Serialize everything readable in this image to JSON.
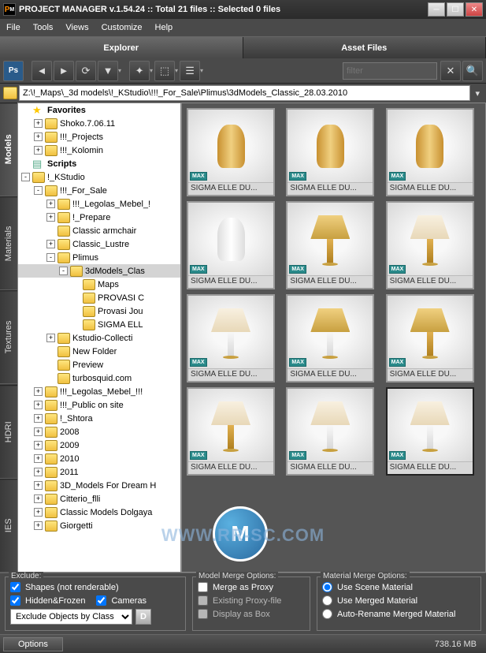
{
  "title": "PROJECT MANAGER v.1.54.24    :: Total 21 files  :: Selected 0 files",
  "menu": [
    "File",
    "Tools",
    "Views",
    "Customize",
    "Help"
  ],
  "main_tabs": {
    "explorer": "Explorer",
    "asset": "Asset Files"
  },
  "filter_placeholder": "filter",
  "path": "Z:\\!_Maps\\_3d models\\!_KStudio\\!!!_For_Sale\\Plimus\\3dModels_Classic_28.03.2010",
  "side_tabs": [
    "Models",
    "Materials",
    "Textures",
    "HDRI",
    "IES"
  ],
  "tree": [
    {
      "lvl": 0,
      "exp": "",
      "icon": "fav",
      "label": "Favorites",
      "bold": true
    },
    {
      "lvl": 1,
      "exp": "+",
      "icon": "fld",
      "label": "Shoko.7.06.11"
    },
    {
      "lvl": 1,
      "exp": "+",
      "icon": "fld",
      "label": "!!!_Projects"
    },
    {
      "lvl": 1,
      "exp": "+",
      "icon": "fld",
      "label": "!!!_Kolomin"
    },
    {
      "lvl": 0,
      "exp": "",
      "icon": "scr",
      "label": "Scripts",
      "bold": true
    },
    {
      "lvl": 0,
      "exp": "-",
      "icon": "fld",
      "label": "!_KStudio"
    },
    {
      "lvl": 1,
      "exp": "-",
      "icon": "fld",
      "label": "!!!_For_Sale"
    },
    {
      "lvl": 2,
      "exp": "+",
      "icon": "fld",
      "label": "!!!_Legolas_Mebel_!"
    },
    {
      "lvl": 2,
      "exp": "+",
      "icon": "fld",
      "label": "!_Prepare"
    },
    {
      "lvl": 2,
      "exp": "",
      "icon": "fld",
      "label": "Classic armchair"
    },
    {
      "lvl": 2,
      "exp": "+",
      "icon": "fld",
      "label": "Classic_Lustre"
    },
    {
      "lvl": 2,
      "exp": "-",
      "icon": "fld",
      "label": "Plimus"
    },
    {
      "lvl": 3,
      "exp": "-",
      "icon": "fld",
      "label": "3dModels_Clas",
      "sel": true
    },
    {
      "lvl": 4,
      "exp": "",
      "icon": "fld",
      "label": "Maps"
    },
    {
      "lvl": 4,
      "exp": "",
      "icon": "fld",
      "label": "PROVASI C"
    },
    {
      "lvl": 4,
      "exp": "",
      "icon": "fld",
      "label": "Provasi Jou"
    },
    {
      "lvl": 4,
      "exp": "",
      "icon": "fld",
      "label": "SIGMA ELL"
    },
    {
      "lvl": 2,
      "exp": "+",
      "icon": "fld",
      "label": "Kstudio-Collecti"
    },
    {
      "lvl": 2,
      "exp": "",
      "icon": "fld",
      "label": "New Folder"
    },
    {
      "lvl": 2,
      "exp": "",
      "icon": "fld",
      "label": "Preview"
    },
    {
      "lvl": 2,
      "exp": "",
      "icon": "fld",
      "label": "turbosquid.com"
    },
    {
      "lvl": 1,
      "exp": "+",
      "icon": "fld",
      "label": "!!!_Legolas_Mebel_!!!"
    },
    {
      "lvl": 1,
      "exp": "+",
      "icon": "fld",
      "label": "!!!_Public on site"
    },
    {
      "lvl": 1,
      "exp": "+",
      "icon": "fld",
      "label": "!_Shtora"
    },
    {
      "lvl": 1,
      "exp": "+",
      "icon": "fld",
      "label": "2008"
    },
    {
      "lvl": 1,
      "exp": "+",
      "icon": "fld",
      "label": "2009"
    },
    {
      "lvl": 1,
      "exp": "+",
      "icon": "fld",
      "label": "2010"
    },
    {
      "lvl": 1,
      "exp": "+",
      "icon": "fld",
      "label": "2011"
    },
    {
      "lvl": 1,
      "exp": "+",
      "icon": "fld",
      "label": "3D_Models For Dream H"
    },
    {
      "lvl": 1,
      "exp": "+",
      "icon": "fld",
      "label": "Citterio_flli"
    },
    {
      "lvl": 1,
      "exp": "+",
      "icon": "fld",
      "label": "Classic Models Dolgaya"
    },
    {
      "lvl": 1,
      "exp": "+",
      "icon": "fld",
      "label": "Giorgetti"
    }
  ],
  "thumbs": [
    {
      "label": "SIGMA ELLE DU...",
      "type": "vase",
      "style": "gold"
    },
    {
      "label": "SIGMA ELLE DU...",
      "type": "vase",
      "style": "gold"
    },
    {
      "label": "SIGMA ELLE DU...",
      "type": "vase",
      "style": "gold"
    },
    {
      "label": "SIGMA ELLE DU...",
      "type": "vase",
      "style": "white"
    },
    {
      "label": "SIGMA ELLE DU...",
      "type": "lamp",
      "shade": "gold",
      "base": "gold"
    },
    {
      "label": "SIGMA ELLE DU...",
      "type": "lamp",
      "shade": "",
      "base": "gold"
    },
    {
      "label": "SIGMA ELLE DU...",
      "type": "lamp",
      "shade": "",
      "base": ""
    },
    {
      "label": "SIGMA ELLE DU...",
      "type": "lamp",
      "shade": "gold",
      "base": ""
    },
    {
      "label": "SIGMA ELLE DU...",
      "type": "lamp",
      "shade": "gold",
      "base": "gold"
    },
    {
      "label": "SIGMA ELLE DU...",
      "type": "lamp",
      "shade": "",
      "base": "gold"
    },
    {
      "label": "SIGMA ELLE DU...",
      "type": "lamp",
      "shade": "",
      "base": ""
    },
    {
      "label": "SIGMA ELLE DU...",
      "type": "lamp",
      "shade": "",
      "base": "",
      "sel": true
    }
  ],
  "max_badge": "MAX",
  "exclude": {
    "title": "Exclude:",
    "shapes": "Shapes (not renderable)",
    "hidden": "Hidden&Frozen",
    "cameras": "Cameras",
    "select": "Exclude Objects by Class",
    "d_btn": "D"
  },
  "model_merge": {
    "title": "Model Merge Options:",
    "proxy": "Merge as Proxy",
    "existing": "Existing Proxy-file",
    "display": "Display as Box"
  },
  "mat_merge": {
    "title": "Material Merge Options:",
    "scene": "Use Scene Material",
    "merged": "Use Merged Material",
    "rename": "Auto-Rename Merged Material"
  },
  "status": {
    "options": "Options",
    "mem": "738.16 MB"
  },
  "watermark": "WWW.RR-SC.COM"
}
